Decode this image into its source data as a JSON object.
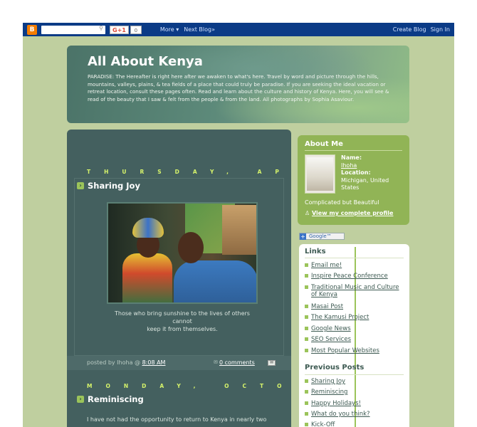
{
  "navbar": {
    "logo": "B",
    "gplus": "G+1",
    "gcount": "0",
    "more": "More ▾",
    "next_blog": "Next Blog»",
    "create_blog": "Create Blog",
    "sign_in": "Sign In"
  },
  "header": {
    "title": "All About Kenya",
    "description": "PARADISE: The Hereafter is right here after we awaken to what's here. Travel by word and picture through the hills, mountains, valleys, plains, & tea fields of a place that could truly be paradise. If you are seeking the ideal vacation or retreat location, consult these pages often. Read and learn about the culture and history of Kenya. Here, you will see & read of the beauty that I saw & felt from the people & from the land. All photographs by Sophia Asaviour."
  },
  "posts": [
    {
      "date": "THURSDAY, APRIL",
      "title": "Sharing Joy",
      "caption_line1": "Those who bring sunshine to the lives of others",
      "caption_line2": "cannot",
      "caption_line3": "keep it from themselves.",
      "posted_by": "posted by Ihoha @",
      "time": "8:08 AM",
      "comments": "0 comments"
    },
    {
      "date": "MONDAY, OCTOBER",
      "title": "Reminiscing",
      "body": "I have not had the opportunity to return to Kenya in nearly two"
    }
  ],
  "about": {
    "heading": "About Me",
    "name_label": "Name:",
    "name": "Ihoha",
    "location_label": "Location:",
    "location": "Michigan, United States",
    "tagline": "Complicated but Beautiful",
    "profile_link": "View my complete profile"
  },
  "google_button": "Google™",
  "links": {
    "heading": "Links",
    "items": [
      "Email me!",
      "Inspire Peace Conference",
      "Traditional Music and Culture of Kenya",
      "Masai Post",
      "The Kamusi Project",
      "Google News",
      "SEO Services",
      "Most Popular Websites"
    ]
  },
  "previous_posts": {
    "heading": "Previous Posts",
    "items": [
      "Sharing Joy",
      "Reminiscing",
      "Happy Holidays!",
      "What do you think?",
      "Kick-Off"
    ]
  },
  "colors": {
    "page_bg": "#bfcf9f",
    "navbar": "#0b3b86",
    "main_bg": "#44605f",
    "accent": "#d6f36b",
    "about_bg": "#91b456"
  }
}
